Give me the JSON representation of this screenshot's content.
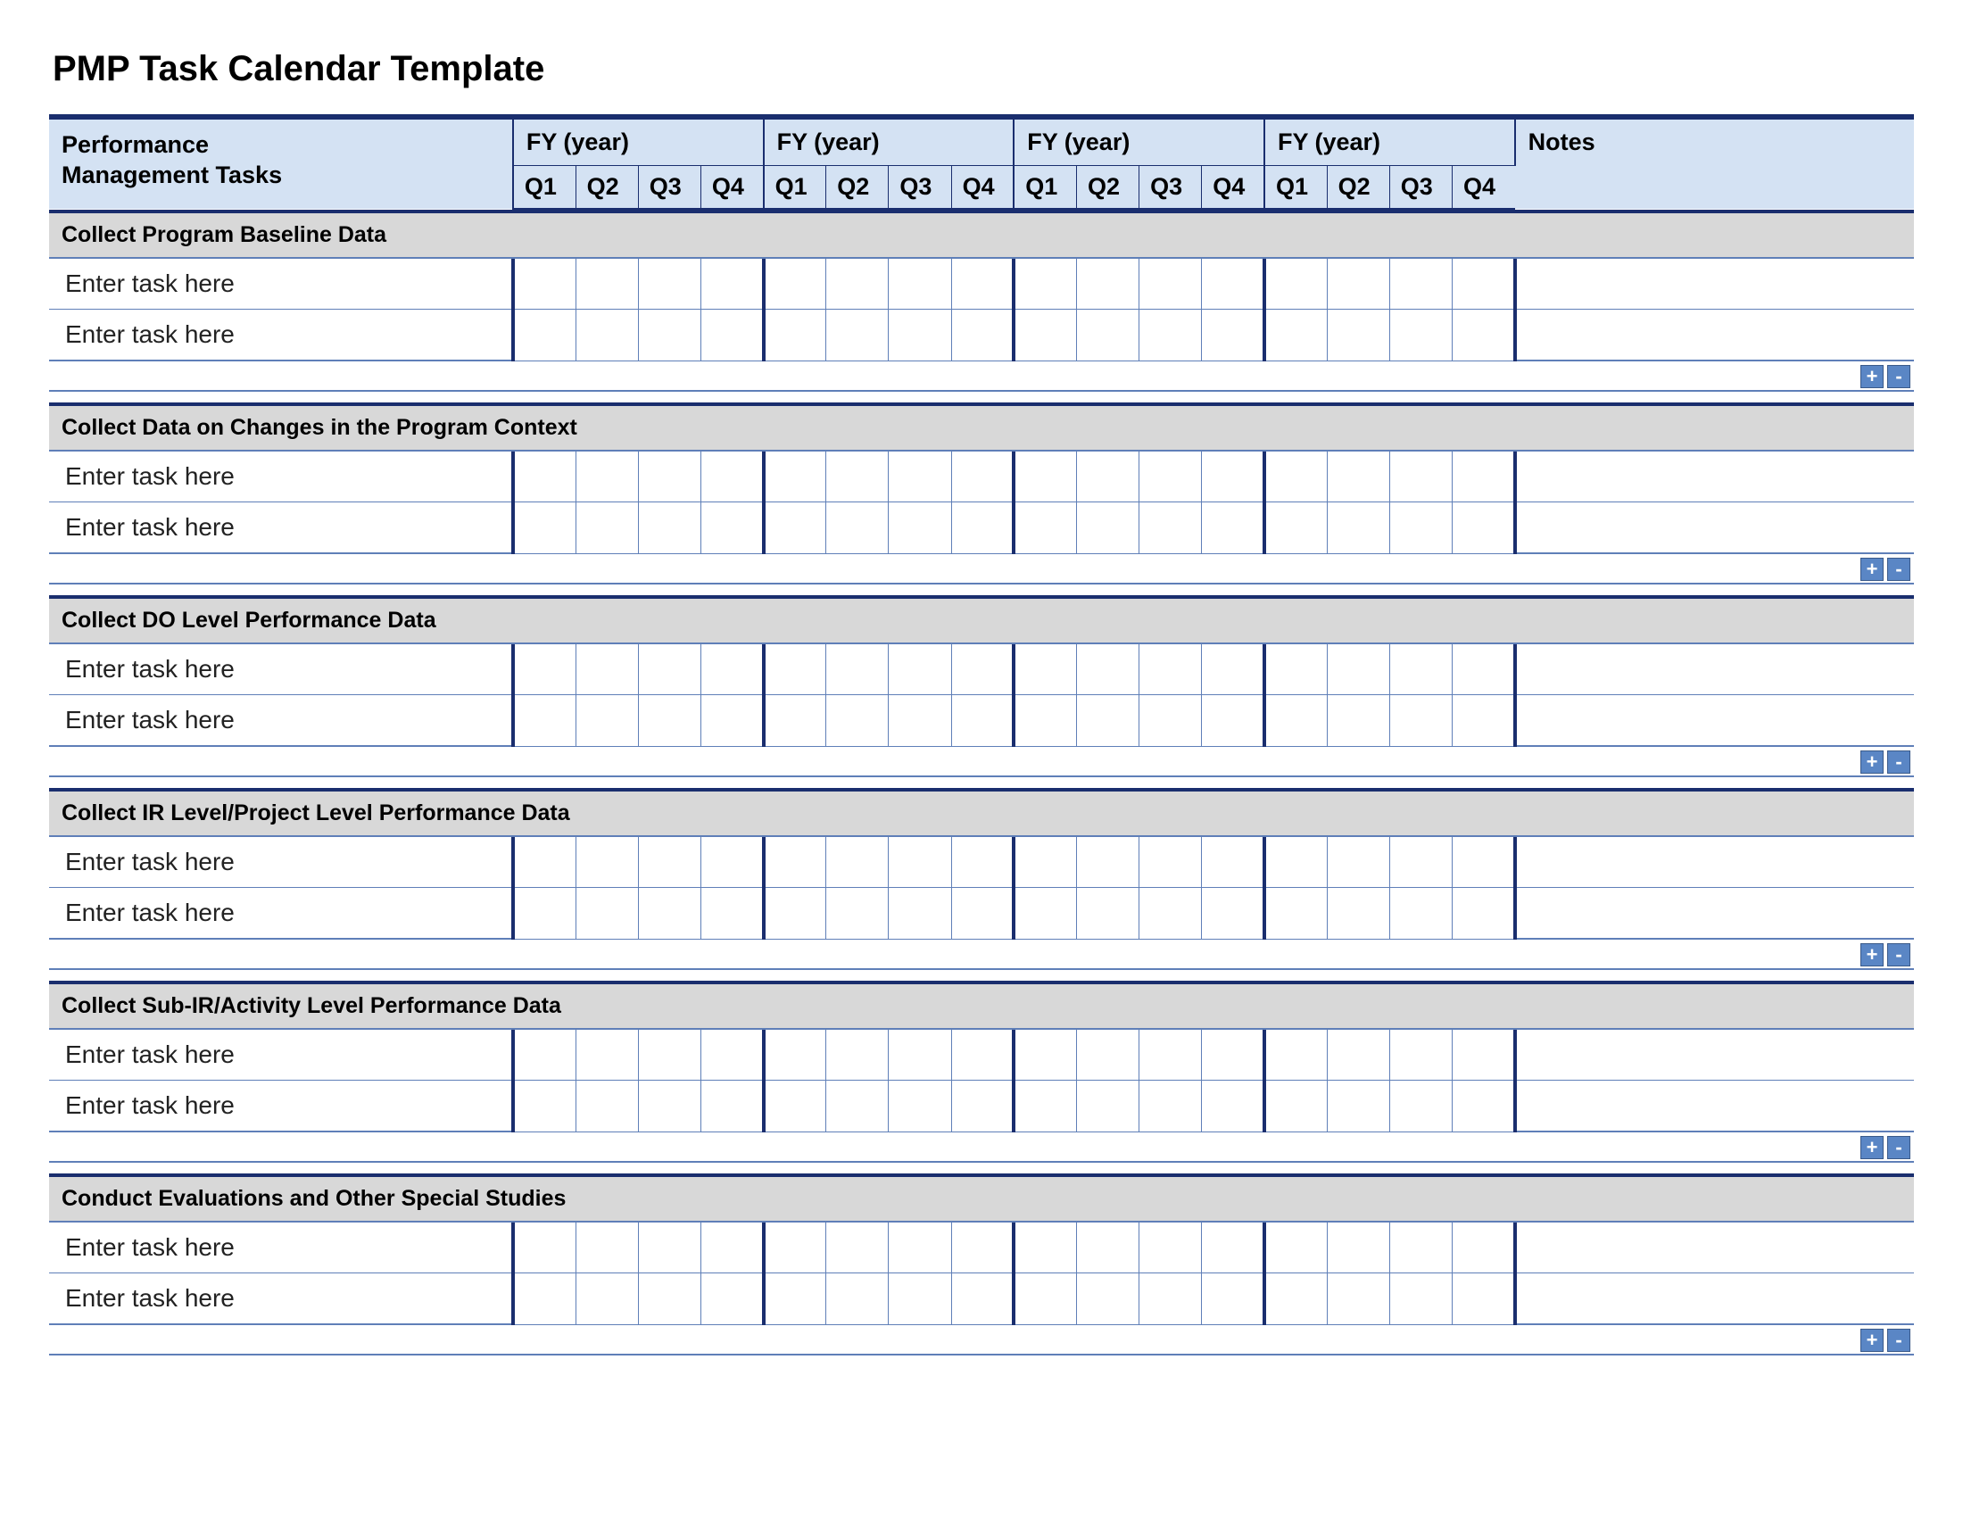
{
  "title": "PMP Task Calendar Template",
  "header": {
    "tasks_label_line1": "Performance",
    "tasks_label_line2": "Management Tasks",
    "fy_label": "FY  (year)",
    "q_labels": [
      "Q1",
      "Q2",
      "Q3",
      "Q4"
    ],
    "notes_label": "Notes"
  },
  "task_placeholder": "Enter task here",
  "controls": {
    "add": "+",
    "remove": "-"
  },
  "sections": [
    {
      "title": "Collect Program Baseline Data"
    },
    {
      "title": "Collect Data on Changes in the Program Context"
    },
    {
      "title": "Collect DO Level Performance Data"
    },
    {
      "title": "Collect IR Level/Project Level Performance Data"
    },
    {
      "title": "Collect Sub-IR/Activity Level Performance Data"
    },
    {
      "title": "Conduct Evaluations and Other Special Studies"
    }
  ]
}
